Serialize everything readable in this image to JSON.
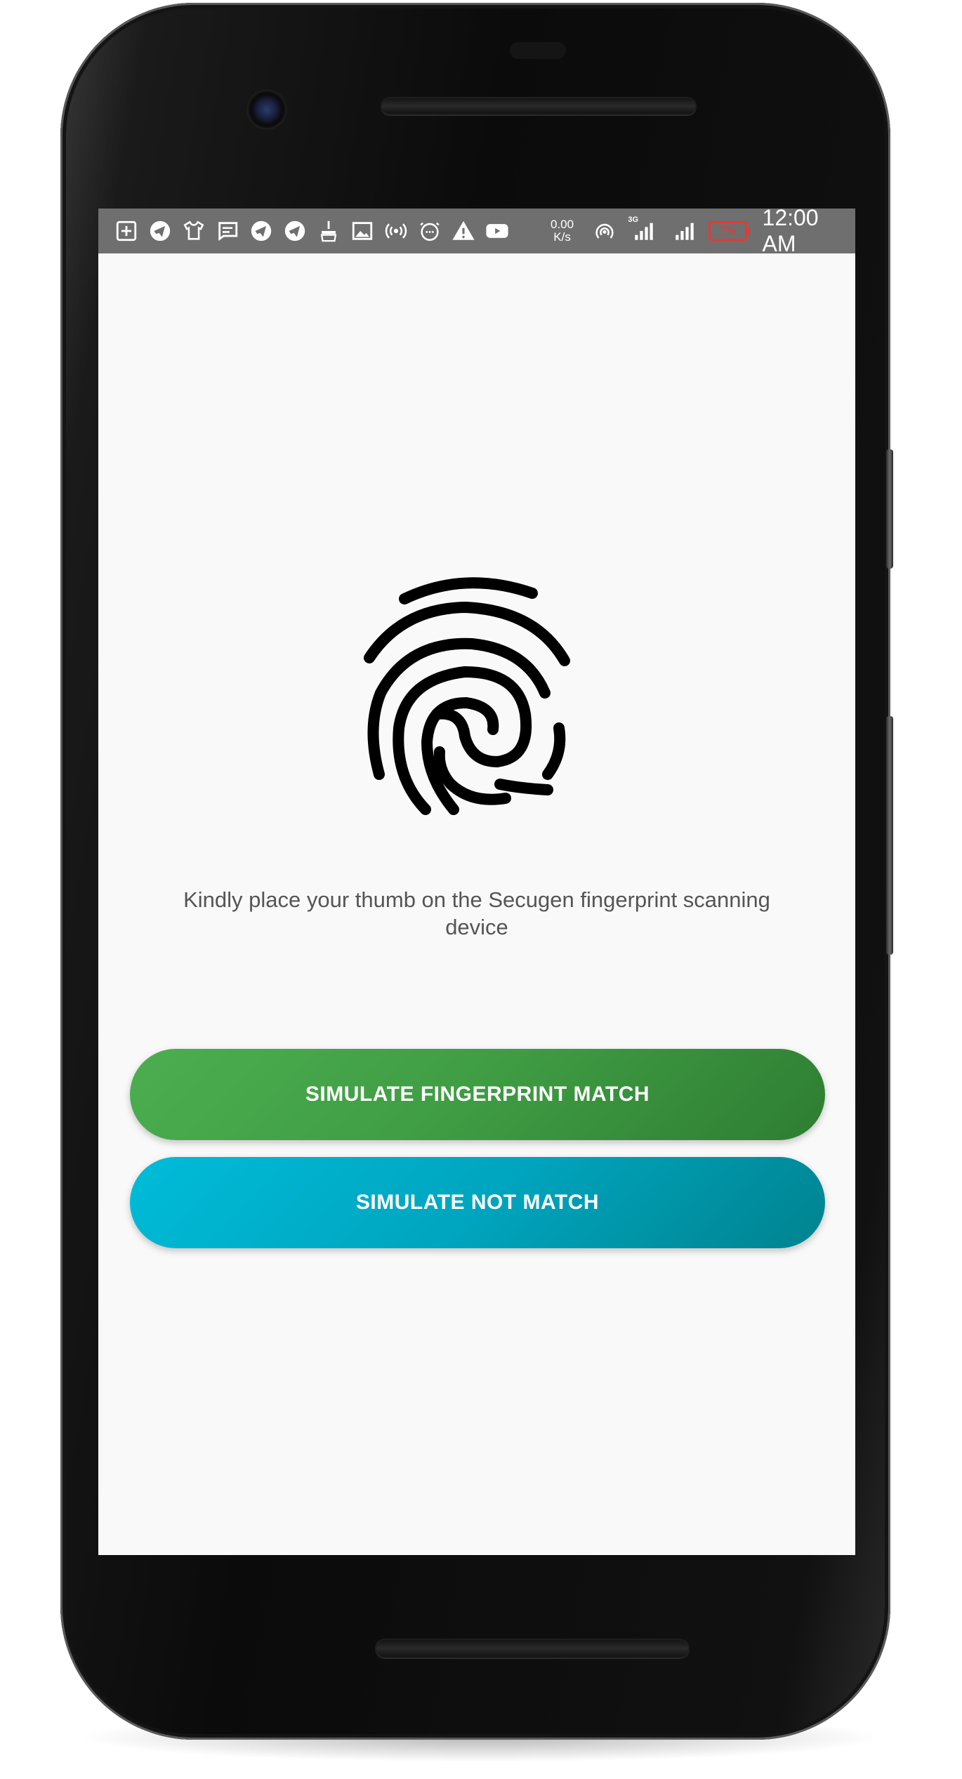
{
  "status_bar": {
    "icons": [
      "plus-box-icon",
      "telegram-icon",
      "tshirt-icon",
      "message-icon",
      "telegram-icon",
      "telegram-icon",
      "cleaner-icon",
      "image-icon",
      "hotspot-icon",
      "clock-dots-icon",
      "warning-icon",
      "youtube-icon"
    ],
    "net_speed_value": "0.00",
    "net_speed_unit": "K/s",
    "network_label": "3G",
    "battery": "7%",
    "time": "12:00 AM"
  },
  "main": {
    "fingerprint_icon": "fingerprint-icon",
    "instruction": "Kindly place your thumb on the Secugen fingerprint scanning device",
    "match_button": "SIMULATE FINGERPRINT MATCH",
    "not_match_button": "SIMULATE NOT MATCH"
  },
  "colors": {
    "status_bar": "#6f6f6f",
    "match_button": "#43a047",
    "not_match_button": "#00acc1",
    "battery_low": "#e53935",
    "background": "#f9f9f9"
  }
}
